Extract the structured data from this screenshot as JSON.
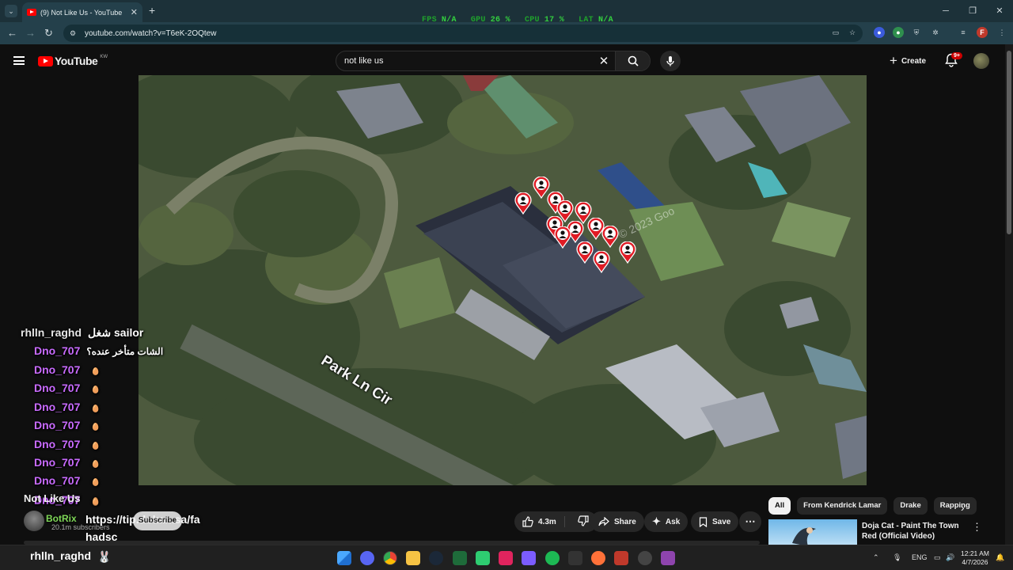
{
  "browser": {
    "tab_title": "(9) Not Like Us - YouTube",
    "url": "youtube.com/watch?v=T6eK-2OQtew",
    "perf": [
      {
        "label": "FPS",
        "value": "N/A"
      },
      {
        "label": "GPU",
        "value": "26 %"
      },
      {
        "label": "CPU",
        "value": "17 %"
      },
      {
        "label": "LAT",
        "value": "N/A"
      }
    ]
  },
  "youtube": {
    "logo": "YouTube",
    "country": "KW",
    "search_value": "not like us",
    "create_label": "Create",
    "notif_badge": "9+"
  },
  "video": {
    "street_label": "Park Ln Cir",
    "watermark": "© 2023 Goo"
  },
  "chat": [
    {
      "nick": "rhlln_raghd",
      "msg": "شغل sailor",
      "type": "white"
    },
    {
      "nick": "Dno_707",
      "msg": "الشات متأخر عنده؟",
      "type": "text"
    },
    {
      "nick": "Dno_707",
      "msg": "🥚",
      "type": "emote"
    },
    {
      "nick": "Dno_707",
      "msg": "🥚",
      "type": "emote"
    },
    {
      "nick": "Dno_707",
      "msg": "🥚",
      "type": "emote"
    },
    {
      "nick": "Dno_707",
      "msg": "🥚",
      "type": "emote"
    },
    {
      "nick": "Dno_707",
      "msg": "🥚",
      "type": "emote"
    },
    {
      "nick": "Dno_707",
      "msg": "🥚",
      "type": "emote"
    },
    {
      "nick": "Dno_707",
      "msg": "🥚",
      "type": "emote"
    },
    {
      "nick": "Dno_707",
      "msg": "🥚",
      "type": "emote"
    },
    {
      "nick": "Dno_707",
      "msg": "🥚",
      "type": "emote"
    }
  ],
  "below_video": {
    "title": "Not Like Us",
    "channel": "BotRix",
    "subscribers": "20.1m subscribers",
    "chat_link": "https://tip.dokan.sa/fa",
    "subscribe_label": "Subscribe",
    "last_chat": "hadsc",
    "likes": "4.3m",
    "share": "Share",
    "ask": "Ask",
    "save": "Save"
  },
  "chips": [
    "All",
    "From Kendrick Lamar",
    "Drake",
    "Rapping"
  ],
  "recommendation": {
    "title": "Doja Cat - Paint The Town Red (Official Video)"
  },
  "taskbar": {
    "user": "rhlln_raghd",
    "lang": "ENG",
    "time": "12:21 AM",
    "date": "4/7/2026"
  }
}
